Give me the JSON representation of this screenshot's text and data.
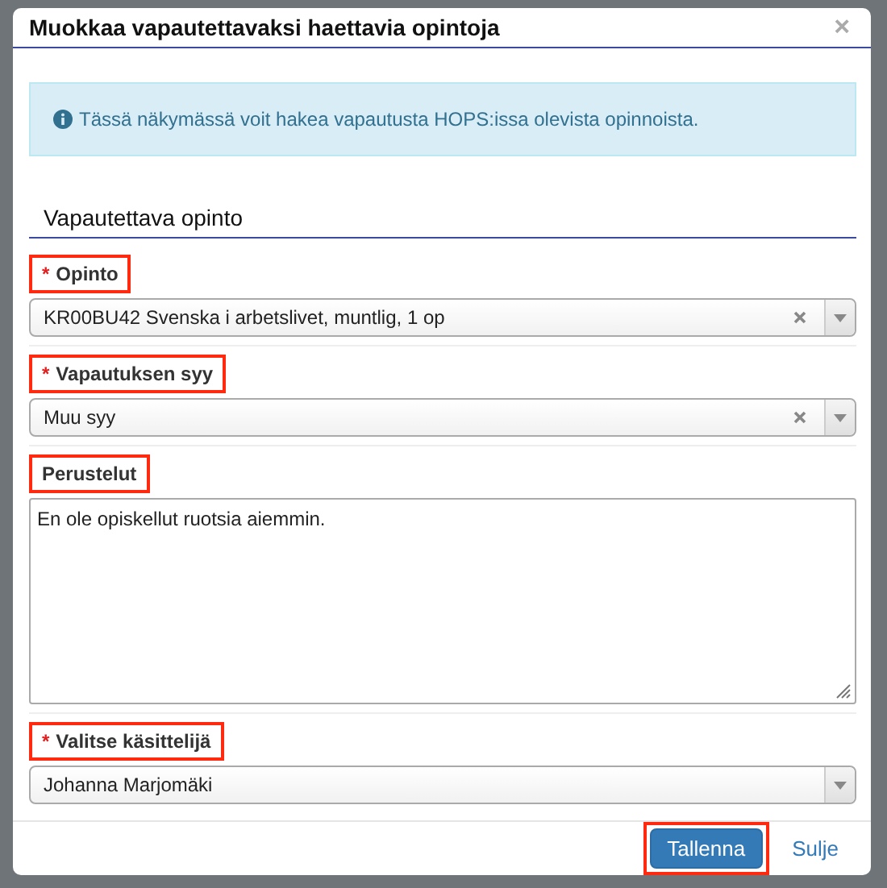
{
  "dialog": {
    "title": "Muokkaa vapautettavaksi haettavia opintoja",
    "close": "×"
  },
  "info": "Tässä näkymässä voit hakea vapautusta HOPS:issa olevista opinnoista.",
  "section": "Vapautettava opinto",
  "fields": [
    {
      "kind": "select",
      "label": "Opinto",
      "required_mark": "*",
      "highlighted": true,
      "value": "KR00BU42 Svenska i arbetslivet, muntlig, 1 op",
      "clearable": true
    },
    {
      "kind": "select",
      "label": "Vapautuksen syy",
      "required_mark": "*",
      "highlighted": true,
      "value": "Muu syy",
      "clearable": true
    },
    {
      "kind": "textarea",
      "label": "Perustelut",
      "highlighted": true,
      "value": "En ole opiskellut ruotsia aiemmin."
    },
    {
      "kind": "select",
      "label": "Valitse käsittelijä",
      "required_mark": "*",
      "highlighted": true,
      "value": "Johanna Marjomäki",
      "clearable": false
    }
  ],
  "buttons": [
    {
      "kind": "primary",
      "label": "Tallenna",
      "highlighted": true
    },
    {
      "kind": "link",
      "label": "Sulje",
      "highlighted": false
    }
  ]
}
